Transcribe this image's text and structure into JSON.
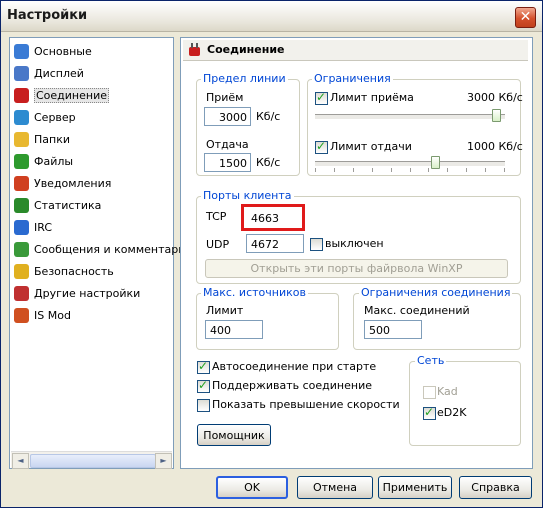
{
  "window": {
    "title": "Настройки",
    "close_glyph": "✕"
  },
  "sidebar": {
    "items": [
      {
        "label": "Основные",
        "icon": "settings-icon",
        "color": "#3a7bd5"
      },
      {
        "label": "Дисплей",
        "icon": "display-icon",
        "color": "#4a78c8"
      },
      {
        "label": "Соединение",
        "icon": "plug-icon",
        "color": "#c81e1e",
        "selected": true
      },
      {
        "label": "Сервер",
        "icon": "server-icon",
        "color": "#2d8bd0"
      },
      {
        "label": "Папки",
        "icon": "folder-icon",
        "color": "#e8b830"
      },
      {
        "label": "Файлы",
        "icon": "files-icon",
        "color": "#2e9a2e"
      },
      {
        "label": "Уведомления",
        "icon": "notifications-icon",
        "color": "#d04020"
      },
      {
        "label": "Статистика",
        "icon": "statistics-icon",
        "color": "#2a8a2a"
      },
      {
        "label": "IRC",
        "icon": "irc-icon",
        "color": "#2a6ad0"
      },
      {
        "label": "Сообщения и комментарии",
        "icon": "messages-icon",
        "color": "#3a9a3a"
      },
      {
        "label": "Безопасность",
        "icon": "lock-icon",
        "color": "#e0b020"
      },
      {
        "label": "Другие настройки",
        "icon": "tools-icon",
        "color": "#c03030"
      },
      {
        "label": "IS Mod",
        "icon": "ismod-icon",
        "color": "#d05020"
      }
    ],
    "scroll_left": "◄",
    "scroll_right": "►"
  },
  "panel": {
    "title": "Соединение",
    "line_limit": {
      "title": "Предел линии",
      "download_label": "Приём",
      "download_value": "3000",
      "download_unit": "Кб/с",
      "upload_label": "Отдача",
      "upload_value": "1500",
      "upload_unit": "Кб/с"
    },
    "limits": {
      "title": "Ограничения",
      "download_limit_label": "Лимит приёма",
      "download_limit_checked": true,
      "download_limit_value": "3000 Кб/с",
      "download_slider_fraction": 0.98,
      "upload_limit_label": "Лимит отдачи",
      "upload_limit_checked": true,
      "upload_limit_value": "1000 Кб/с",
      "upload_slider_fraction": 0.64
    },
    "client_ports": {
      "title": "Порты клиента",
      "tcp_label": "TCP",
      "tcp_value": "4663",
      "udp_label": "UDP",
      "udp_value": "4672",
      "udp_disabled_label": "выключен",
      "udp_disabled_checked": false,
      "firewall_button": "Открыть эти порты файрвола WinXP"
    },
    "max_sources": {
      "title": "Макс. источников",
      "limit_label": "Лимит",
      "limit_value": "400"
    },
    "connection_limits": {
      "title": "Ограничения соединения",
      "max_conn_label": "Макс. соединений",
      "max_conn_value": "500"
    },
    "options": [
      {
        "label": "Автосоединение при старте",
        "checked": true
      },
      {
        "label": "Поддерживать соединение",
        "checked": true
      },
      {
        "label": "Показать превышение скорости",
        "checked": false
      }
    ],
    "network": {
      "title": "Сеть",
      "kad_label": "Kad",
      "kad_checked": false,
      "kad_disabled": true,
      "ed2k_label": "eD2K",
      "ed2k_checked": true
    },
    "wizard_button": "Помощник"
  },
  "footer": {
    "ok": "OK",
    "cancel": "Отмена",
    "apply": "Применить",
    "help": "Справка"
  },
  "colors": {
    "group_title": "#0046d5",
    "highlight": "#e01a1a",
    "window_bg": "#ece9d8"
  }
}
